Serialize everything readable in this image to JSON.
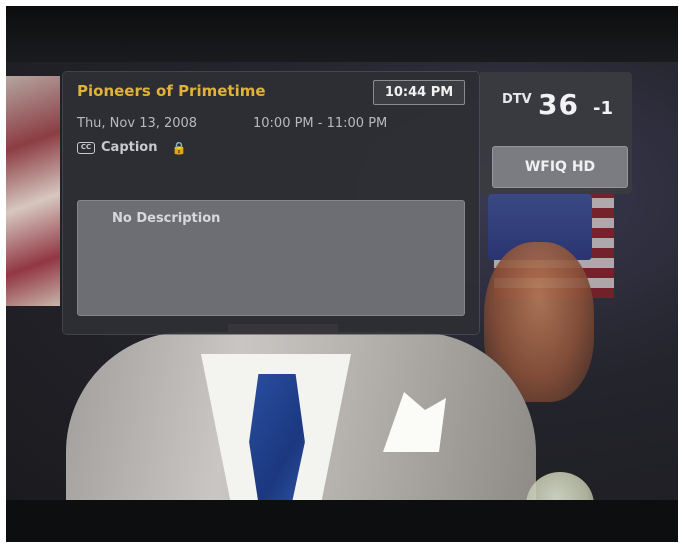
{
  "info": {
    "title": "Pioneers of Primetime",
    "clock": "10:44 PM",
    "air_date": "Thu, Nov 13, 2008",
    "time_range": "10:00 PM - 11:00 PM",
    "caption_label": "Caption",
    "rating": "🔒",
    "description": "No Description"
  },
  "channel": {
    "type": "DTV",
    "number": "36",
    "subchannel": "-1",
    "station": "WFIQ HD"
  },
  "icons": {
    "caption": "closed-caption-icon"
  },
  "colors": {
    "title": "#e0b23a",
    "panel_bg": "#2e2f34",
    "description_bg": "#6d6e73"
  }
}
